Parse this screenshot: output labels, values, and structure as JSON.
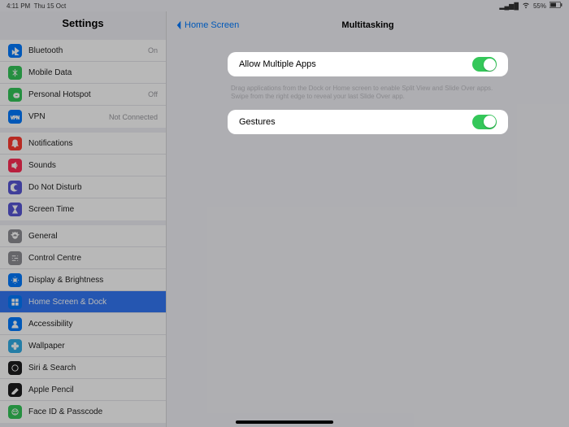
{
  "status": {
    "time": "4:11 PM",
    "date": "Thu 15 Oct",
    "battery_pct": "55%"
  },
  "sidebar": {
    "title": "Settings",
    "g1": [
      {
        "label": "Bluetooth",
        "value": "On",
        "icon": "bluetooth",
        "c": "ic-blue"
      },
      {
        "label": "Mobile Data",
        "icon": "antenna",
        "c": "ic-green"
      },
      {
        "label": "Personal Hotspot",
        "value": "Off",
        "icon": "link",
        "c": "ic-green"
      },
      {
        "label": "VPN",
        "value": "Not Connected",
        "icon": "vpn",
        "c": "ic-blue"
      }
    ],
    "g2": [
      {
        "label": "Notifications",
        "icon": "bell",
        "c": "ic-red"
      },
      {
        "label": "Sounds",
        "icon": "speaker",
        "c": "ic-pink"
      },
      {
        "label": "Do Not Disturb",
        "icon": "moon",
        "c": "ic-indigo"
      },
      {
        "label": "Screen Time",
        "icon": "hourglass",
        "c": "ic-indigo"
      }
    ],
    "g3": [
      {
        "label": "General",
        "icon": "gear",
        "c": "ic-grey"
      },
      {
        "label": "Control Centre",
        "icon": "switches",
        "c": "ic-grey"
      },
      {
        "label": "Display & Brightness",
        "icon": "sun",
        "c": "ic-blue"
      },
      {
        "label": "Home Screen & Dock",
        "icon": "grid",
        "c": "ic-blue",
        "selected": true
      },
      {
        "label": "Accessibility",
        "icon": "person",
        "c": "ic-blue"
      },
      {
        "label": "Wallpaper",
        "icon": "flower",
        "c": "ic-teal"
      },
      {
        "label": "Siri & Search",
        "icon": "siri",
        "c": "ic-dark"
      },
      {
        "label": "Apple Pencil",
        "icon": "pencil",
        "c": "ic-dark"
      },
      {
        "label": "Face ID & Passcode",
        "icon": "face",
        "c": "ic-green"
      }
    ]
  },
  "nav": {
    "back": "Home Screen",
    "title": "Multitasking"
  },
  "options": {
    "allow": {
      "label": "Allow Multiple Apps",
      "on": true,
      "help": "Drag applications from the Dock or Home screen to enable Split View and Slide Over apps. Swipe from the right edge to reveal your last Slide Over app."
    },
    "gestures": {
      "label": "Gestures",
      "on": true
    }
  }
}
